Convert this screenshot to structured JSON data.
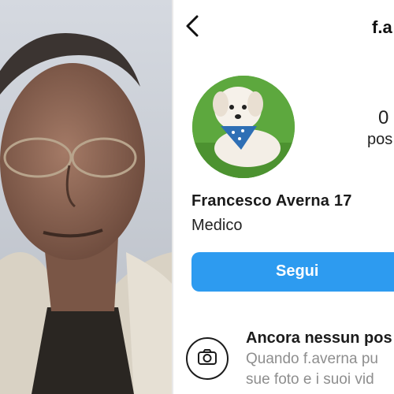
{
  "profile": {
    "username": "f.a",
    "full_name": "Francesco Averna 17",
    "bio": "Medico",
    "posts_count": "0",
    "posts_label": "pos",
    "follow_label": "Segui",
    "empty_title": "Ancora nessun pos",
    "empty_desc_line1": "Quando f.averna pu",
    "empty_desc_line2": "sue foto e i suoi vid"
  },
  "icons": {
    "back": "chevron-left-icon",
    "camera": "camera-icon"
  },
  "colors": {
    "follow_button": "#2d9bf0",
    "secondary_text": "#8e8e8e"
  }
}
